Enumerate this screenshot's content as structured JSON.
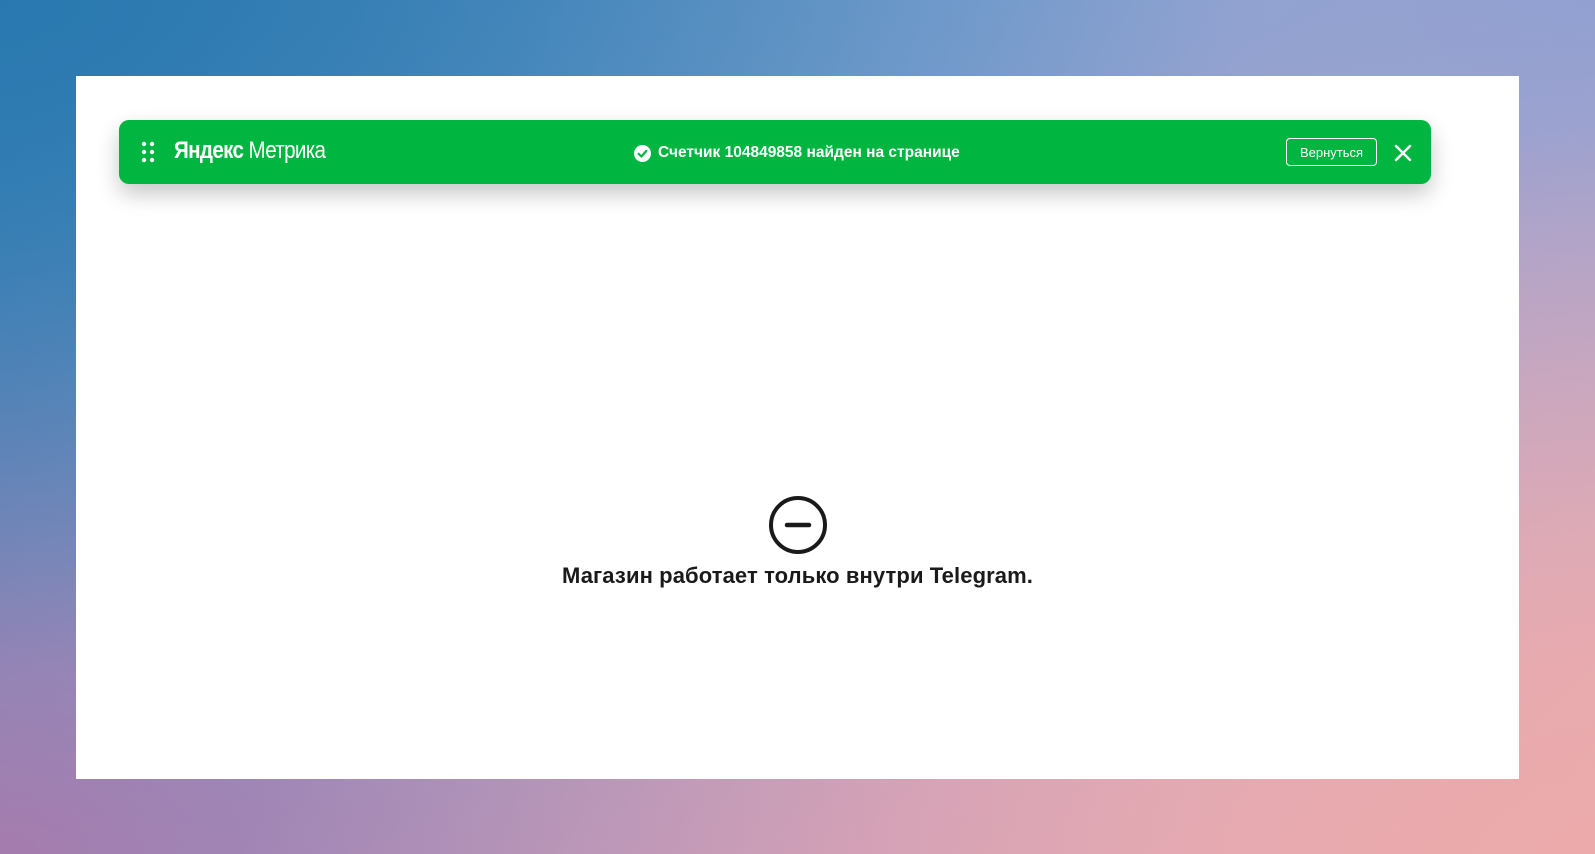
{
  "metrika_bar": {
    "brand_primary": "Яндекс",
    "brand_secondary": "Метрика",
    "status_text": "Счетчик 104849858 найден на странице",
    "return_label": "Вернуться",
    "bar_color": "#00b640",
    "icons": {
      "drag": "drag-handle-icon",
      "status": "check-circle-icon",
      "close": "close-icon"
    }
  },
  "page": {
    "notice_text": "Магазин работает только внутри Telegram.",
    "notice_icon": "block-icon"
  }
}
